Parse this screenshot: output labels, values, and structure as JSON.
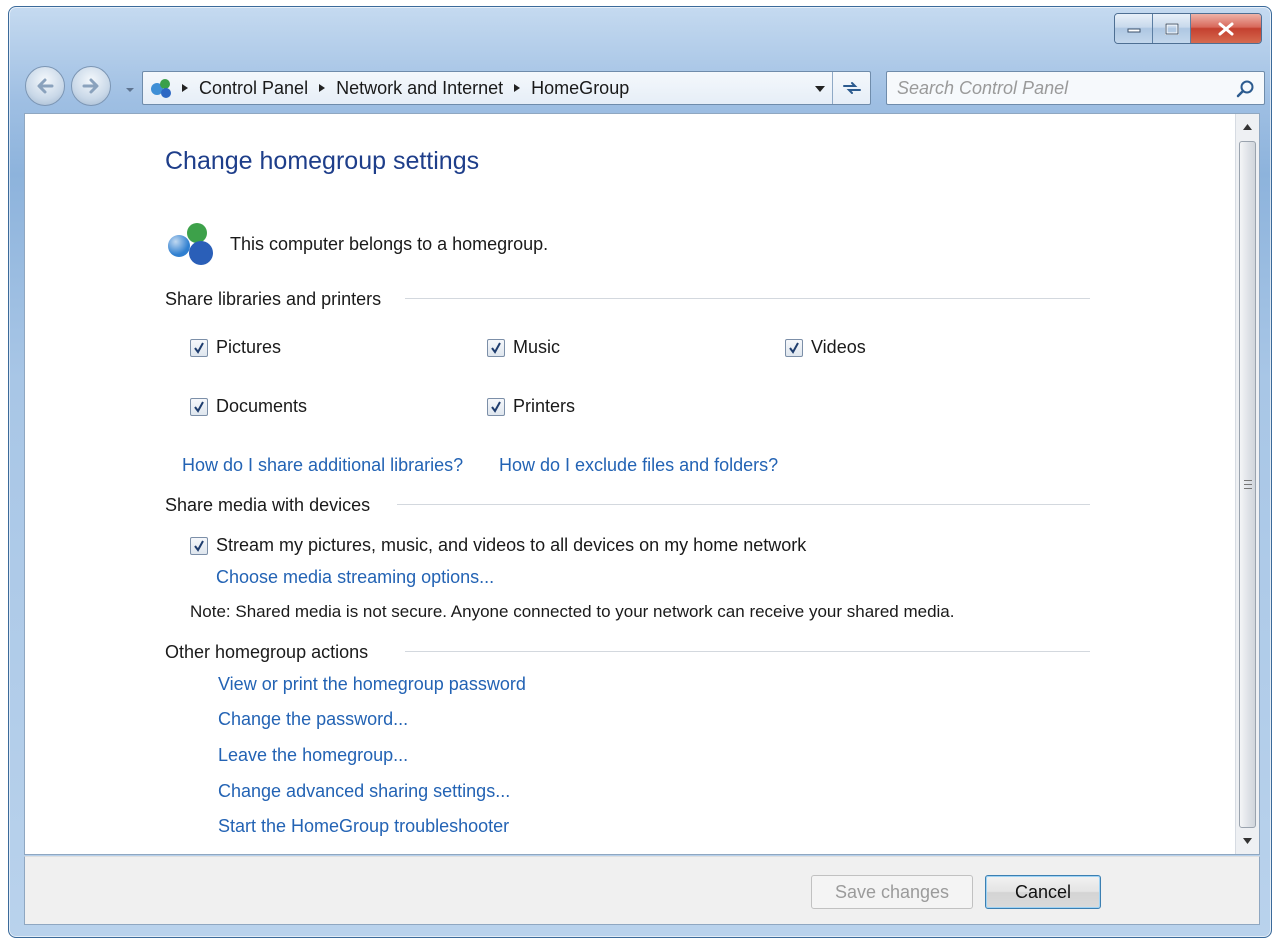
{
  "breadcrumbs": [
    "Control Panel",
    "Network and Internet",
    "HomeGroup"
  ],
  "search": {
    "placeholder": "Search Control Panel"
  },
  "main": {
    "title": "Change homegroup settings",
    "status": "This computer belongs to a homegroup.",
    "share_libraries": {
      "heading": "Share libraries and printers",
      "items": [
        {
          "label": "Pictures",
          "checked": true
        },
        {
          "label": "Music",
          "checked": true
        },
        {
          "label": "Videos",
          "checked": true
        },
        {
          "label": "Documents",
          "checked": true
        },
        {
          "label": "Printers",
          "checked": true
        }
      ],
      "links": [
        "How do I share additional libraries?",
        "How do I exclude files and folders?"
      ]
    },
    "share_media": {
      "heading": "Share media with devices",
      "stream_label": "Stream my pictures, music, and videos to all devices on my home network",
      "stream_checked": true,
      "options_link": "Choose media streaming options...",
      "note": "Note: Shared media is not secure. Anyone connected to your network can receive your shared media."
    },
    "other_actions": {
      "heading": "Other homegroup actions",
      "links": [
        "View or print the homegroup password",
        "Change the password...",
        "Leave the homegroup...",
        "Change advanced sharing settings...",
        "Start the HomeGroup troubleshooter"
      ]
    }
  },
  "footer": {
    "save_label": "Save changes",
    "cancel_label": "Cancel"
  },
  "colors": {
    "link": "#2363b4",
    "title": "#1e3e8a",
    "close_button": "#c4402f"
  }
}
